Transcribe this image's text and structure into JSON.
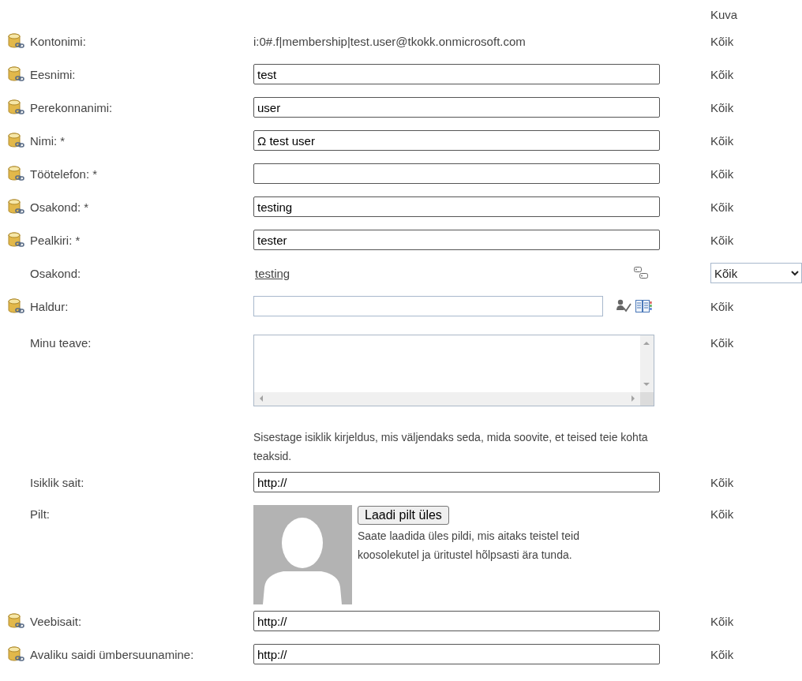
{
  "header": {
    "visibility_column": "Kuva"
  },
  "rows": [
    {
      "kind": "text",
      "label": "Kontonimi:",
      "linked": true,
      "value": "i:0#.f|membership|test.user@tkokk.onmicrosoft.com",
      "visibility": "Kõik"
    },
    {
      "kind": "input",
      "label": "Eesnimi:",
      "linked": true,
      "value": "test",
      "visibility": "Kõik"
    },
    {
      "kind": "input",
      "label": "Perekonnanimi:",
      "linked": true,
      "value": "user",
      "visibility": "Kõik"
    },
    {
      "kind": "input",
      "label": "Nimi: *",
      "linked": true,
      "value": "Ω test user",
      "visibility": "Kõik"
    },
    {
      "kind": "input",
      "label": "Töötelefon: *",
      "linked": true,
      "visibility": "Kõik"
    },
    {
      "kind": "input",
      "label": "Osakond: *",
      "linked": true,
      "value": "testing",
      "visibility": "Kõik"
    },
    {
      "kind": "input",
      "label": "Pealkiri: *",
      "linked": true,
      "value": "tester",
      "visibility": "Kõik"
    },
    {
      "kind": "link",
      "label": "Osakond:",
      "linked": false,
      "value": "testing",
      "visibility": "Kõik",
      "visibility_dropdown": true
    },
    {
      "kind": "people",
      "label": "Haldur:",
      "linked": true,
      "visibility": "Kõik"
    },
    {
      "kind": "textarea",
      "label": "Minu teave:",
      "linked": false,
      "description": "Sisestage isiklik kirjeldus, mis väljendaks seda, mida soovite, et teised teie kohta teaksid.",
      "visibility": "Kõik"
    },
    {
      "kind": "input",
      "label": "Isiklik sait:",
      "linked": false,
      "value": "http://",
      "visibility": "Kõik"
    },
    {
      "kind": "picture",
      "label": "Pilt:",
      "linked": false,
      "button": "Laadi pilt üles",
      "description": "Saate laadida üles pildi, mis aitaks teistel teid koosolekutel ja üritustel hõlpsasti ära tunda.",
      "visibility": "Kõik"
    },
    {
      "kind": "input",
      "label": "Veebisait:",
      "linked": true,
      "value": "http://",
      "visibility": "Kõik"
    },
    {
      "kind": "input",
      "label": "Avaliku saidi ümbersuunamine:",
      "linked": true,
      "value": "http://",
      "visibility": "Kõik"
    }
  ]
}
